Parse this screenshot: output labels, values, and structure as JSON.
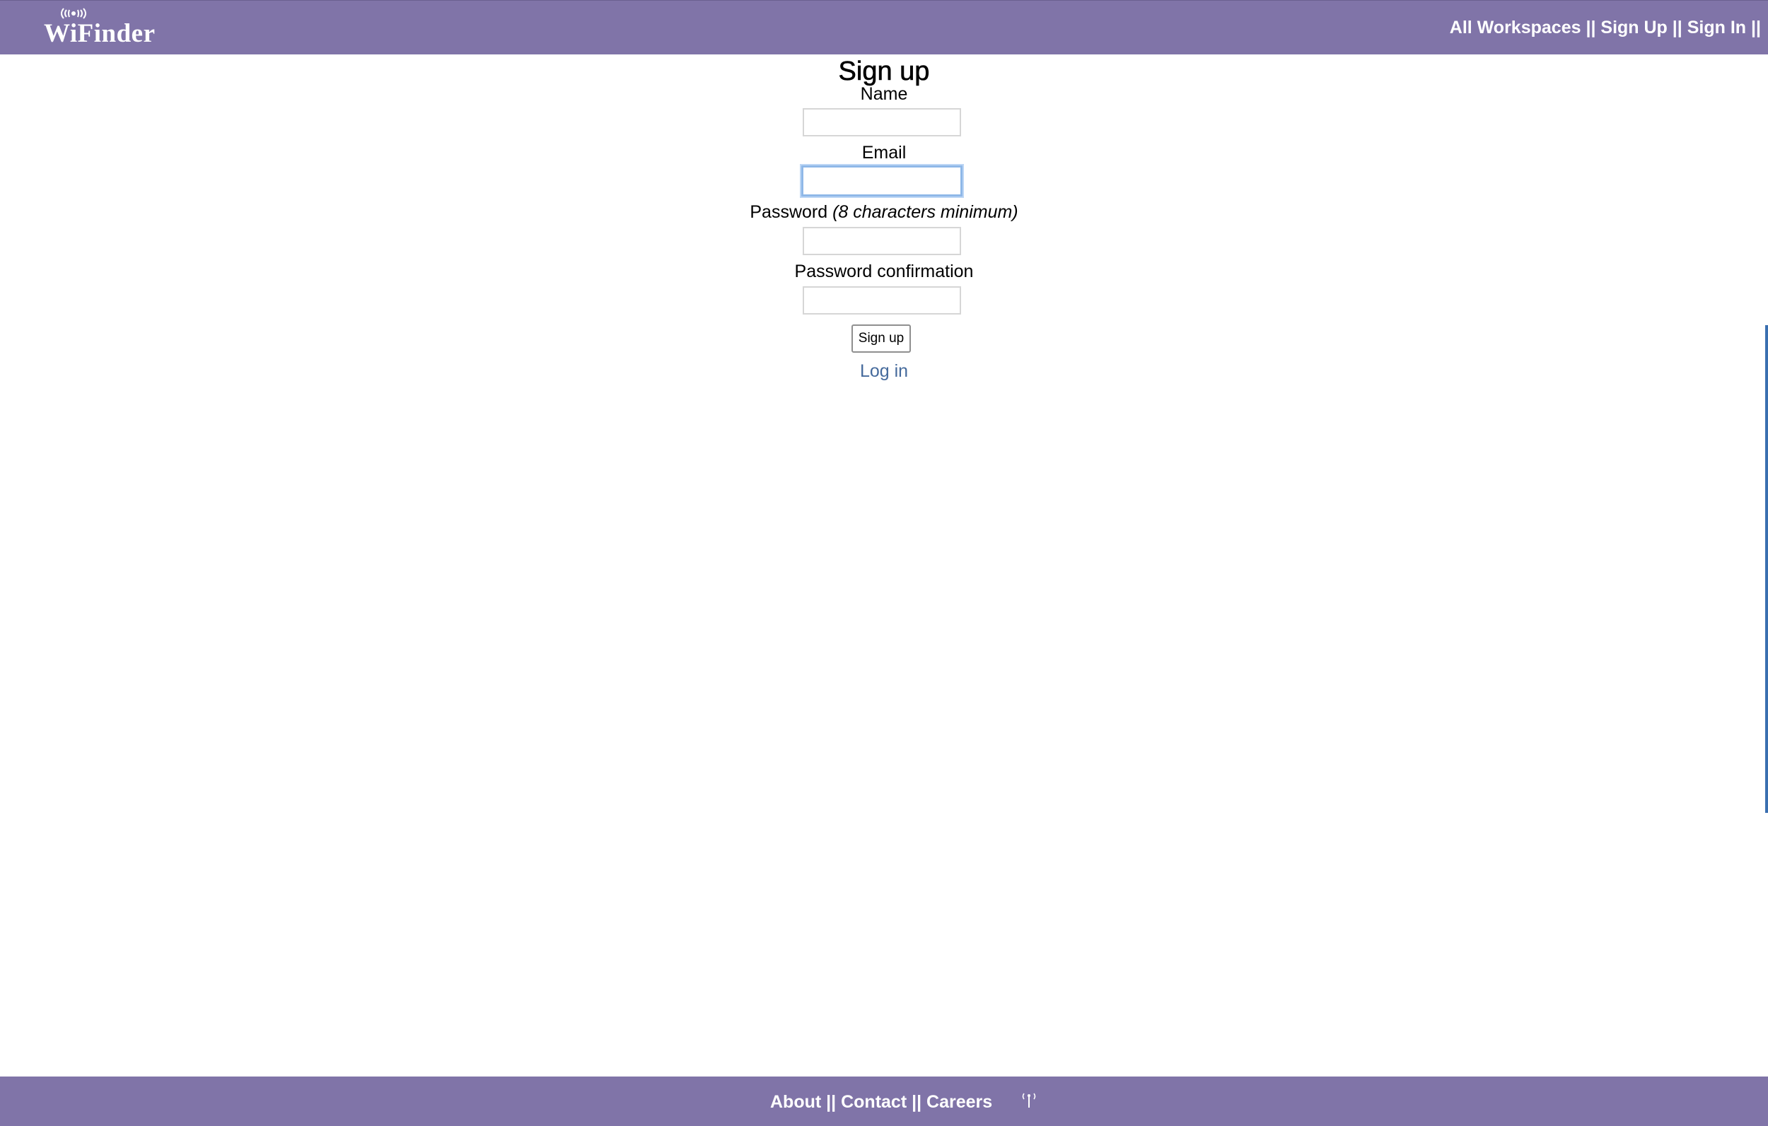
{
  "header": {
    "logo_text": "WiFinder",
    "nav": {
      "all_workspaces": "All Workspaces",
      "sign_up": "Sign Up",
      "sign_in": "Sign In",
      "separator": "||"
    }
  },
  "form": {
    "title": "Sign up",
    "name_label": "Name",
    "email_label": "Email",
    "password_label": "Password",
    "password_hint": "(8 characters minimum)",
    "password_confirmation_label": "Password confirmation",
    "name_value": "",
    "email_value": "",
    "password_value": "",
    "password_confirmation_value": "",
    "submit_label": "Sign up",
    "login_link": "Log in"
  },
  "footer": {
    "about": "About",
    "contact": "Contact",
    "careers": "Careers",
    "separator": "||"
  },
  "colors": {
    "bar": "#8074a8",
    "link": "#456a9c",
    "focus": "#8fb8e8"
  }
}
